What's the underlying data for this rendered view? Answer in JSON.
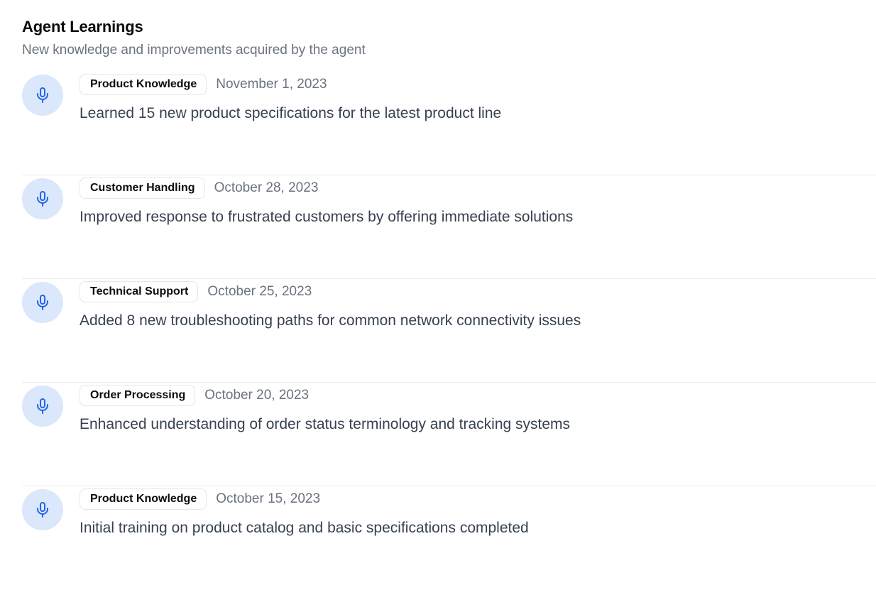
{
  "header": {
    "title": "Agent Learnings",
    "subtitle": "New knowledge and improvements acquired by the agent"
  },
  "icons": {
    "item_icon": "microphone-icon"
  },
  "colors": {
    "icon_bg": "#dbe7fb",
    "icon_fg": "#2563eb"
  },
  "learnings": [
    {
      "category": "Product Knowledge",
      "date": "November 1, 2023",
      "description": "Learned 15 new product specifications for the latest product line"
    },
    {
      "category": "Customer Handling",
      "date": "October 28, 2023",
      "description": "Improved response to frustrated customers by offering immediate solutions"
    },
    {
      "category": "Technical Support",
      "date": "October 25, 2023",
      "description": "Added 8 new troubleshooting paths for common network connectivity issues"
    },
    {
      "category": "Order Processing",
      "date": "October 20, 2023",
      "description": "Enhanced understanding of order status terminology and tracking systems"
    },
    {
      "category": "Product Knowledge",
      "date": "October 15, 2023",
      "description": "Initial training on product catalog and basic specifications completed"
    }
  ]
}
